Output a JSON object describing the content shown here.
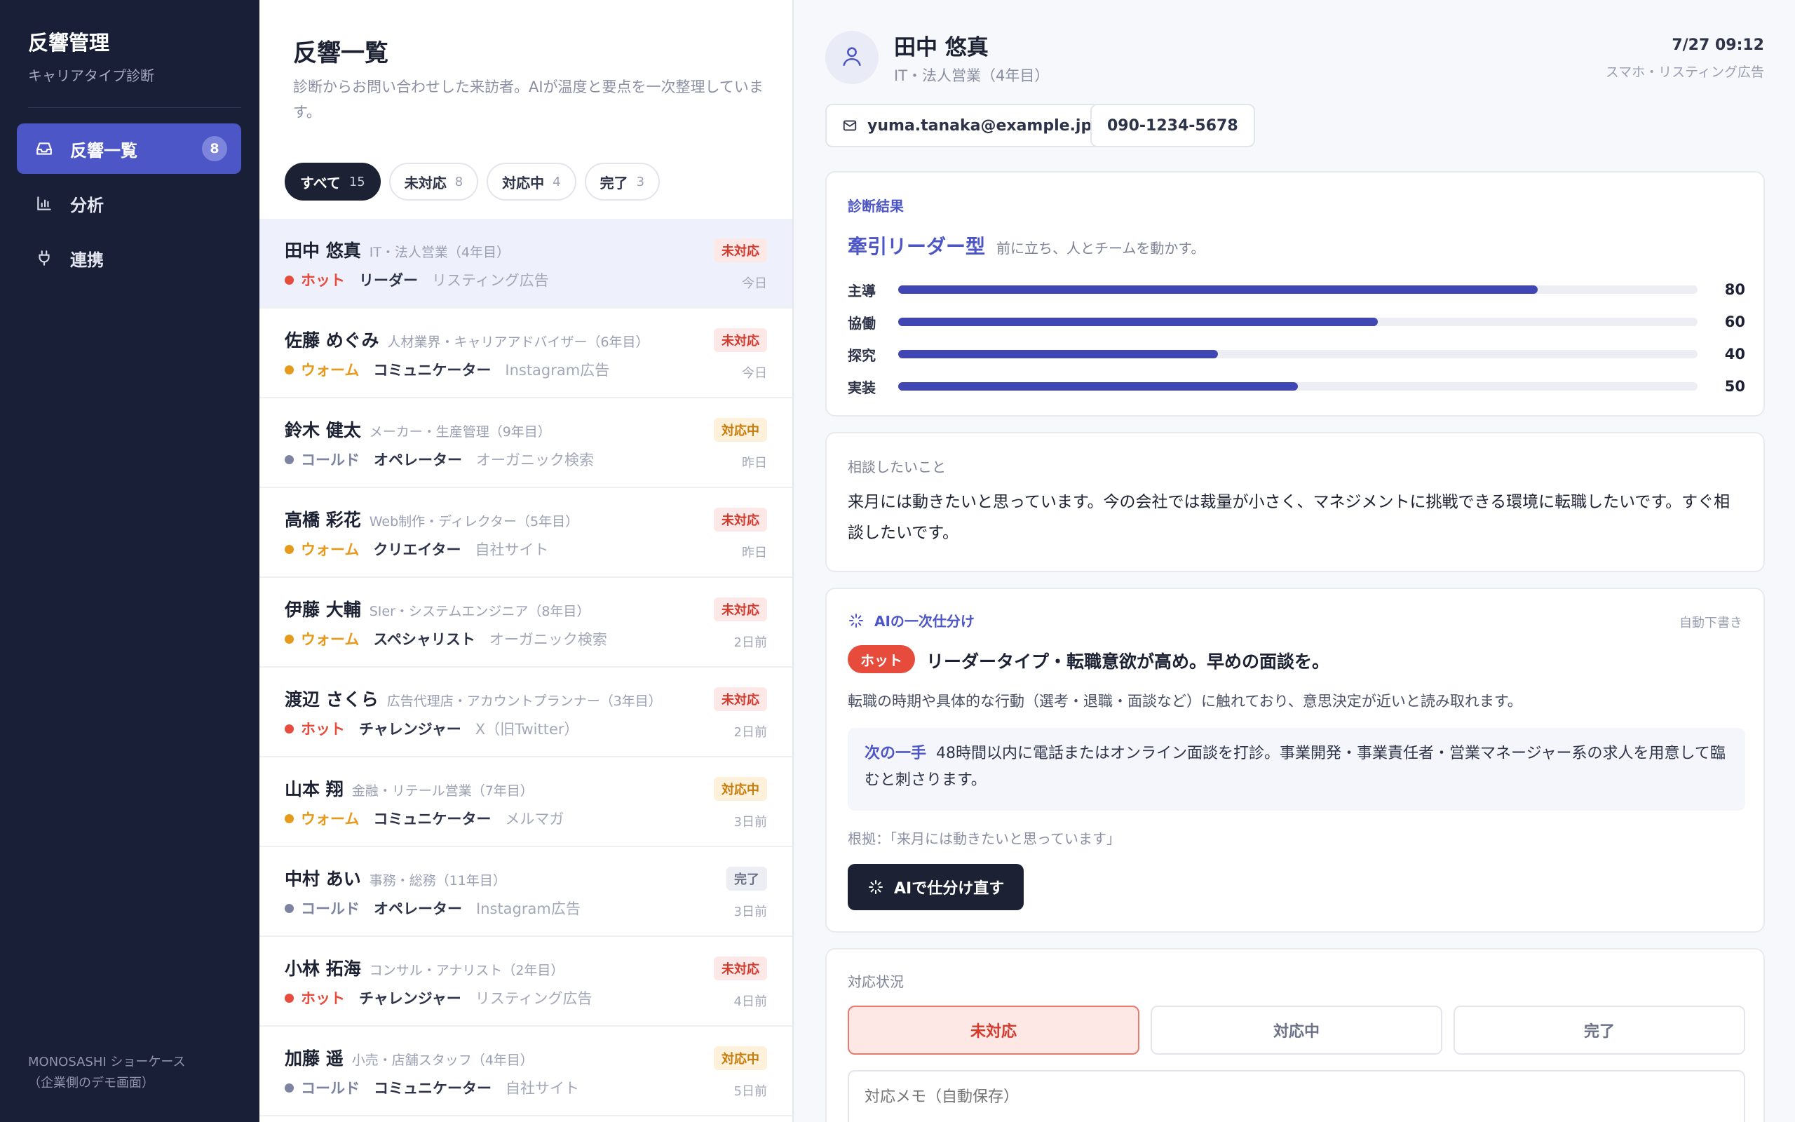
{
  "sidebar": {
    "title": "反響管理",
    "subtitle": "キャリアタイプ診断",
    "items": [
      {
        "label": "反響一覧",
        "badge": "8"
      },
      {
        "label": "分析"
      },
      {
        "label": "連携"
      }
    ],
    "footer_line1": "MONOSASHI ショーケース",
    "footer_line2": "（企業側のデモ画面）"
  },
  "list": {
    "title": "反響一覧",
    "description": "診断からお問い合わせした来訪者。AIが温度と要点を一次整理しています。",
    "filters": [
      {
        "label": "すべて",
        "count": "15"
      },
      {
        "label": "未対応",
        "count": "8"
      },
      {
        "label": "対応中",
        "count": "4"
      },
      {
        "label": "完了",
        "count": "3"
      }
    ],
    "rows": [
      {
        "name": "田中 悠真",
        "job": "IT・法人営業（4年目）",
        "temp": "ホット",
        "type": "リーダー",
        "source": "リスティング広告",
        "status": "未対応",
        "date": "今日"
      },
      {
        "name": "佐藤 めぐみ",
        "job": "人材業界・キャリアアドバイザー（6年目）",
        "temp": "ウォーム",
        "type": "コミュニケーター",
        "source": "Instagram広告",
        "status": "未対応",
        "date": "今日"
      },
      {
        "name": "鈴木 健太",
        "job": "メーカー・生産管理（9年目）",
        "temp": "コールド",
        "type": "オペレーター",
        "source": "オーガニック検索",
        "status": "対応中",
        "date": "昨日"
      },
      {
        "name": "高橋 彩花",
        "job": "Web制作・ディレクター（5年目）",
        "temp": "ウォーム",
        "type": "クリエイター",
        "source": "自社サイト",
        "status": "未対応",
        "date": "昨日"
      },
      {
        "name": "伊藤 大輔",
        "job": "SIer・システムエンジニア（8年目）",
        "temp": "ウォーム",
        "type": "スペシャリスト",
        "source": "オーガニック検索",
        "status": "未対応",
        "date": "2日前"
      },
      {
        "name": "渡辺 さくら",
        "job": "広告代理店・アカウントプランナー（3年目）",
        "temp": "ホット",
        "type": "チャレンジャー",
        "source": "X（旧Twitter）",
        "status": "未対応",
        "date": "2日前"
      },
      {
        "name": "山本 翔",
        "job": "金融・リテール営業（7年目）",
        "temp": "ウォーム",
        "type": "コミュニケーター",
        "source": "メルマガ",
        "status": "対応中",
        "date": "3日前"
      },
      {
        "name": "中村 あい",
        "job": "事務・総務（11年目）",
        "temp": "コールド",
        "type": "オペレーター",
        "source": "Instagram広告",
        "status": "完了",
        "date": "3日前"
      },
      {
        "name": "小林 拓海",
        "job": "コンサル・アナリスト（2年目）",
        "temp": "ホット",
        "type": "チャレンジャー",
        "source": "リスティング広告",
        "status": "未対応",
        "date": "4日前"
      },
      {
        "name": "加藤 遥",
        "job": "小売・店舗スタッフ（4年目）",
        "temp": "コールド",
        "type": "コミュニケーター",
        "source": "自社サイト",
        "status": "対応中",
        "date": "5日前"
      }
    ]
  },
  "detail": {
    "name": "田中 悠真",
    "job": "IT・法人営業（4年目）",
    "time": "7/27 09:12",
    "source": "スマホ・リスティング広告",
    "email": "yuma.tanaka@example.jp",
    "phone": "090-1234-5678",
    "diagnosis": {
      "label": "診断結果",
      "type_name": "牽引リーダー型",
      "type_desc": "前に立ち、人とチームを動かす。",
      "scores": [
        {
          "label": "主導",
          "value": 80
        },
        {
          "label": "協働",
          "value": 60
        },
        {
          "label": "探究",
          "value": 40
        },
        {
          "label": "実装",
          "value": 50
        }
      ]
    },
    "consult": {
      "label": "相談したいこと",
      "text": "来月には動きたいと思っています。今の会社では裁量が小さく、マネジメントに挑戦できる環境に転職したいです。すぐ相談したいです。"
    },
    "ai": {
      "label": "AIの一次仕分け",
      "auto": "自動下書き",
      "badge": "ホット",
      "headline": "リーダータイプ・転職意欲が高め。早めの面談を。",
      "body": "転職の時期や具体的な行動（選考・退職・面談など）に触れており、意思決定が近いと読み取れます。",
      "next_label": "次の一手",
      "next_text": "48時間以内に電話またはオンライン面談を打診。事業開発・事業責任者・営業マネージャー系の求人を用意して臨むと刺さります。",
      "reason": "根拠：「来月には動きたいと思っています」",
      "button": "AIで仕分け直す"
    },
    "status_section": {
      "label": "対応状況",
      "options": [
        "未対応",
        "対応中",
        "完了"
      ],
      "selected": "未対応",
      "memo_placeholder": "対応メモ（自動保存）"
    }
  },
  "colors": {
    "accent": "#4d56c6",
    "sidebar_bg": "#1a1f38",
    "hot": "#e64b3c",
    "warm": "#e59a1b",
    "cold": "#7d84a1"
  }
}
